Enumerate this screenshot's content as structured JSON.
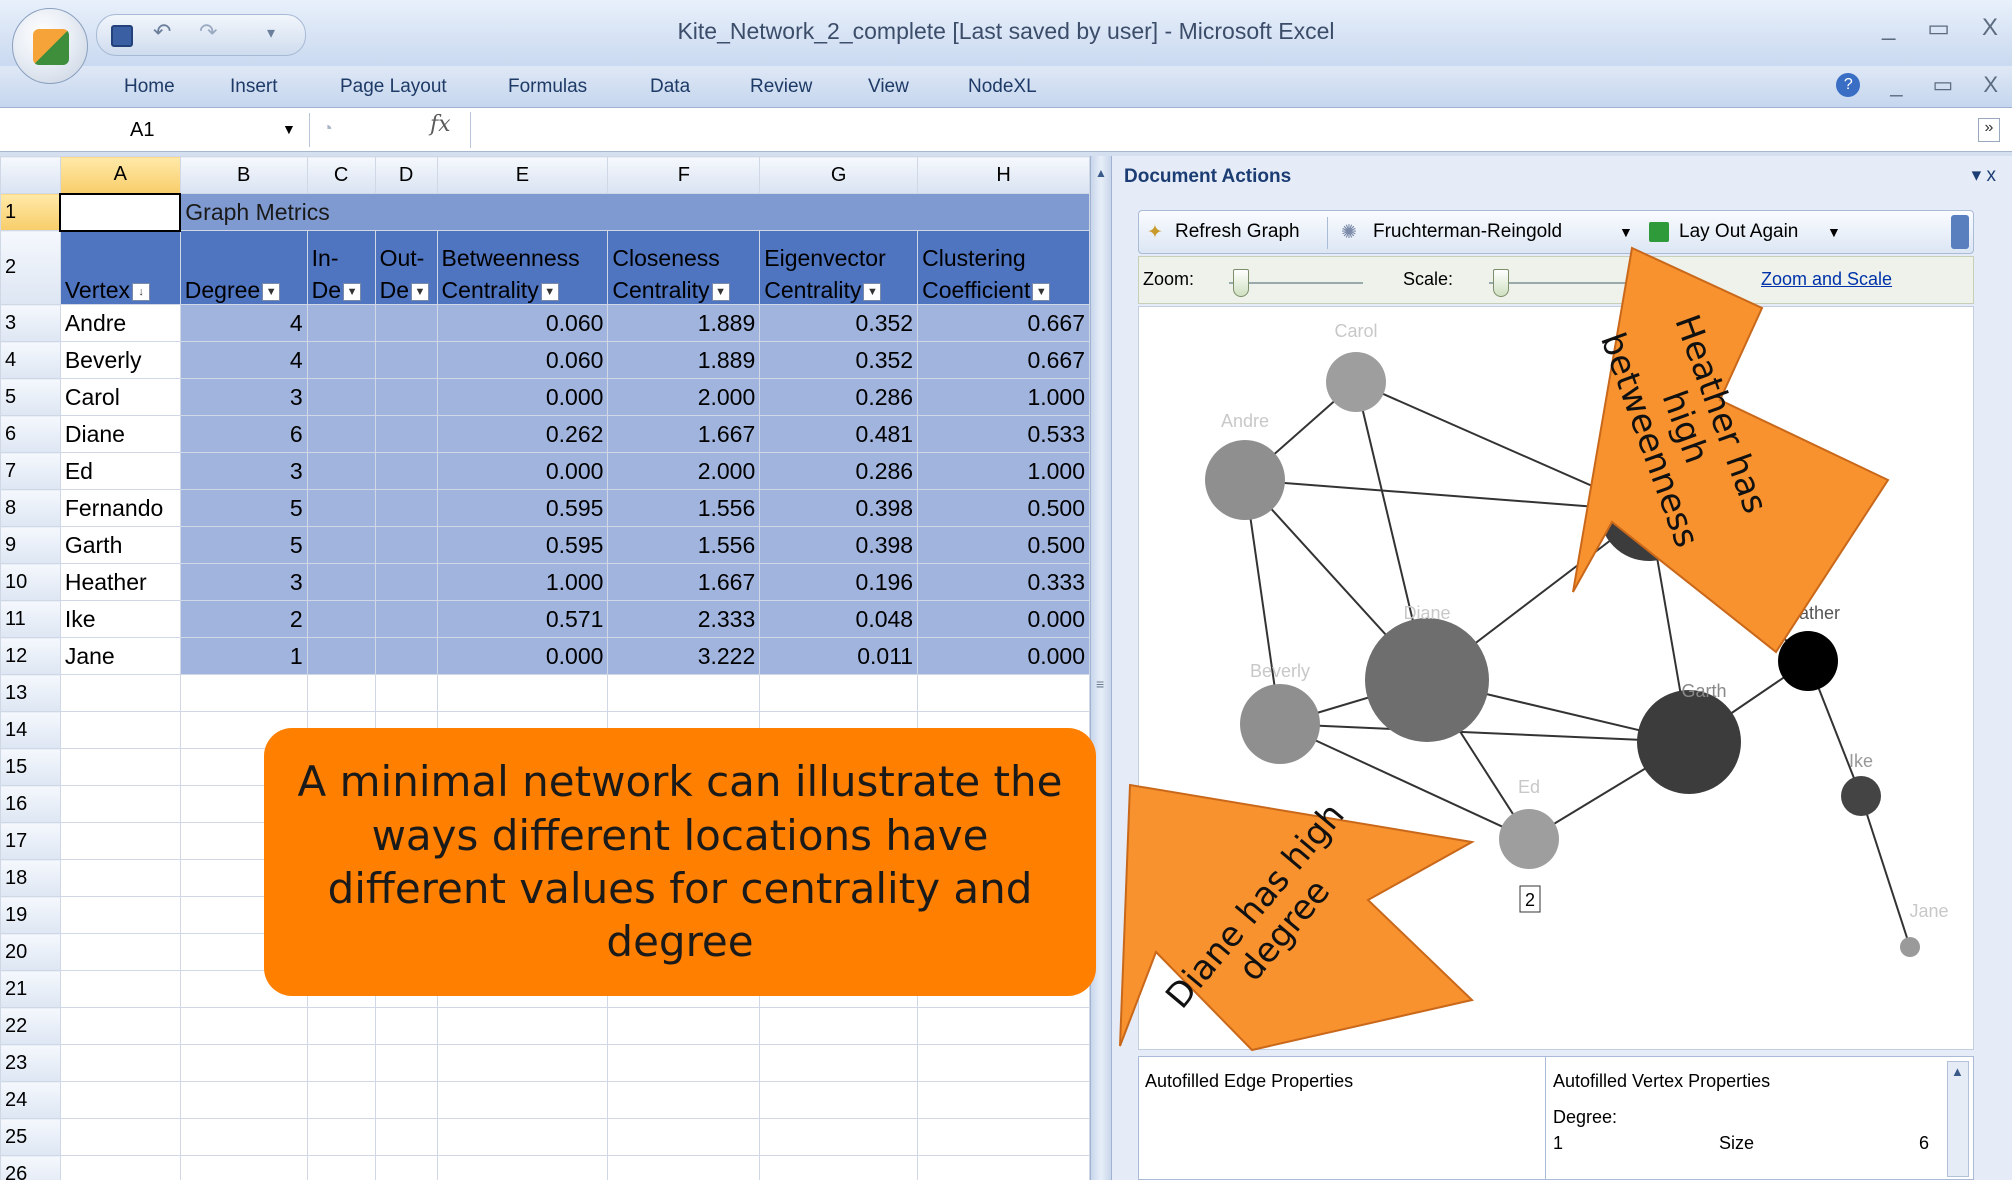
{
  "window": {
    "title": "Kite_Network_2_complete [Last saved by user] - Microsoft Excel",
    "controls": [
      "_",
      "▭",
      "X"
    ]
  },
  "ribbon": {
    "tabs": [
      "Home",
      "Insert",
      "Page Layout",
      "Formulas",
      "Data",
      "Review",
      "View",
      "NodeXL"
    ],
    "right_controls": [
      "?",
      "_",
      "▭",
      "X"
    ]
  },
  "formula_bar": {
    "name_box": "A1",
    "fx": "fx",
    "value": ""
  },
  "sheet": {
    "columns": [
      "A",
      "B",
      "C",
      "D",
      "E",
      "F",
      "G",
      "H"
    ],
    "rows": [
      1,
      2,
      3,
      4,
      5,
      6,
      7,
      8,
      9,
      10,
      11,
      12,
      13,
      14,
      15,
      16,
      17,
      18,
      19,
      20,
      21,
      22,
      23,
      24,
      25,
      26
    ],
    "group_header": "Graph Metrics",
    "headers_line1": [
      "",
      "",
      "In-",
      "Out-",
      "Betweenness",
      "Closeness",
      "Eigenvector",
      "Clustering"
    ],
    "headers_line2": [
      "Vertex",
      "Degree",
      "De",
      "De",
      "Centrality",
      "Centrality",
      "Centrality",
      "Coefficient"
    ],
    "data": [
      [
        "Andre",
        "4",
        "",
        "",
        "0.060",
        "1.889",
        "0.352",
        "0.667"
      ],
      [
        "Beverly",
        "4",
        "",
        "",
        "0.060",
        "1.889",
        "0.352",
        "0.667"
      ],
      [
        "Carol",
        "3",
        "",
        "",
        "0.000",
        "2.000",
        "0.286",
        "1.000"
      ],
      [
        "Diane",
        "6",
        "",
        "",
        "0.262",
        "1.667",
        "0.481",
        "0.533"
      ],
      [
        "Ed",
        "3",
        "",
        "",
        "0.000",
        "2.000",
        "0.286",
        "1.000"
      ],
      [
        "Fernando",
        "5",
        "",
        "",
        "0.595",
        "1.556",
        "0.398",
        "0.500"
      ],
      [
        "Garth",
        "5",
        "",
        "",
        "0.595",
        "1.556",
        "0.398",
        "0.500"
      ],
      [
        "Heather",
        "3",
        "",
        "",
        "1.000",
        "1.667",
        "0.196",
        "0.333"
      ],
      [
        "Ike",
        "2",
        "",
        "",
        "0.571",
        "2.333",
        "0.048",
        "0.000"
      ],
      [
        "Jane",
        "1",
        "",
        "",
        "0.000",
        "3.222",
        "0.011",
        "0.000"
      ]
    ]
  },
  "panel": {
    "title": "Document Actions",
    "close": "▾ x",
    "refresh": "Refresh Graph",
    "layout": "Fruchterman-Reingold",
    "lay_out_again": "Lay Out Again",
    "zoom_label": "Zoom:",
    "scale_label": "Scale:",
    "reset_link": "Zoom and Scale",
    "edge_props": "Autofilled Edge Properties",
    "vertex_props": "Autofilled Vertex Properties",
    "degree_label": "Degree:",
    "degree_min": "1",
    "size_label": "Size",
    "size_value": "6",
    "tooltip": "2"
  },
  "graph": {
    "nodes": [
      {
        "name": "Carol"
      },
      {
        "name": "Andre"
      },
      {
        "name": "Fernando"
      },
      {
        "name": "Diane"
      },
      {
        "name": "Heather"
      },
      {
        "name": "Beverly"
      },
      {
        "name": "Garth"
      },
      {
        "name": "Ike"
      },
      {
        "name": "Ed"
      },
      {
        "name": "Jane"
      }
    ]
  },
  "annotations": {
    "callout": "A minimal network can illustrate the ways different locations have different values for centrality and degree",
    "arrow_heather": "Heather has high betweenness",
    "arrow_diane": "Diane has high degree"
  },
  "colors": {
    "callout": "#ff7f00",
    "table_header": "#4f74c0",
    "table_cell": "#a0b4de"
  }
}
